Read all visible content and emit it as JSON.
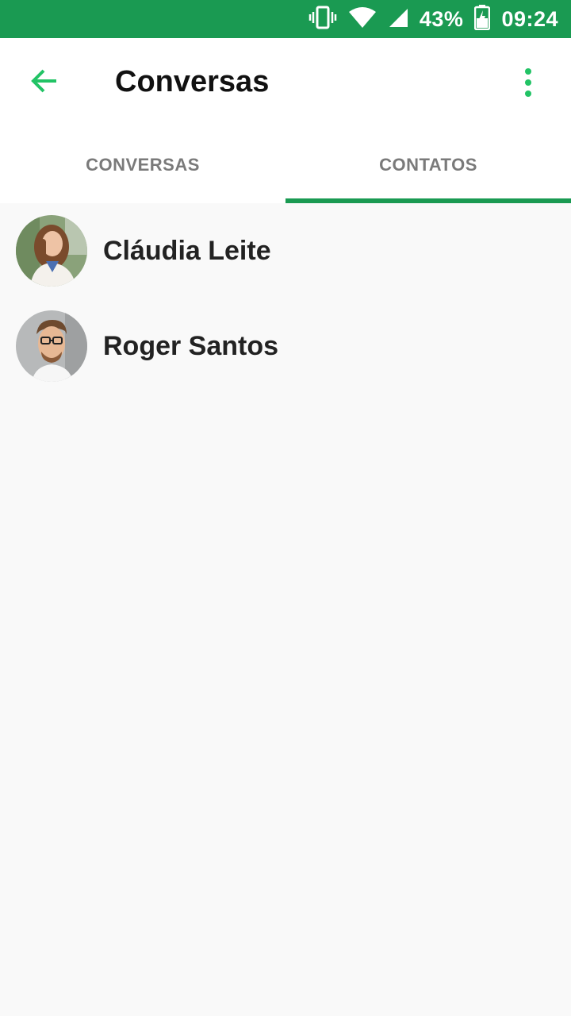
{
  "status_bar": {
    "battery": "43%",
    "time": "09:24",
    "icons": [
      "vibrate-icon",
      "wifi-icon",
      "signal-icon",
      "battery-charging-icon"
    ]
  },
  "toolbar": {
    "title": "Conversas",
    "back_icon": "arrow-back-icon",
    "menu_icon": "more-vert-icon",
    "accent": "#22c365"
  },
  "tabs": [
    {
      "label": "CONVERSAS",
      "selected": false
    },
    {
      "label": "CONTATOS",
      "selected": true
    }
  ],
  "contacts": [
    {
      "name": "Cláudia Leite",
      "avatar": "woman-photo"
    },
    {
      "name": "Roger Santos",
      "avatar": "man-photo"
    }
  ],
  "colors": {
    "primary": "#1a9a52",
    "accent": "#22c365",
    "background": "#f9f9f9"
  }
}
